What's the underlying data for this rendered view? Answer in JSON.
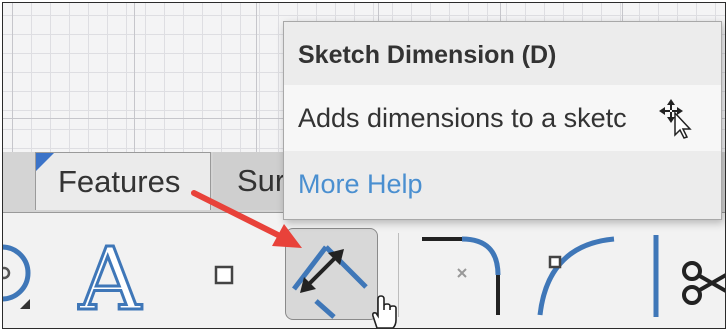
{
  "tabs": [
    {
      "label": "Features",
      "active": true
    },
    {
      "label": "Sur",
      "active": false
    }
  ],
  "tooltip": {
    "title": "Sketch Dimension (D)",
    "description": "Adds dimensions to a sketc",
    "more_help": "More Help"
  },
  "toolbar": {
    "tools": [
      {
        "icon": "circle-tool-icon"
      },
      {
        "icon": "text-tool-icon",
        "glyph": "A"
      },
      {
        "icon": "point-tool-icon"
      },
      {
        "icon": "sketch-dimension-icon",
        "hovered": true
      },
      {
        "icon": "fillet-icon"
      },
      {
        "icon": "arc-icon"
      },
      {
        "icon": "trim-icon"
      }
    ]
  },
  "colors": {
    "accent": "#3b73c8",
    "link": "#4a8fd0",
    "annotation_arrow": "#e8423a",
    "tool_blue": "#3f77b8"
  }
}
